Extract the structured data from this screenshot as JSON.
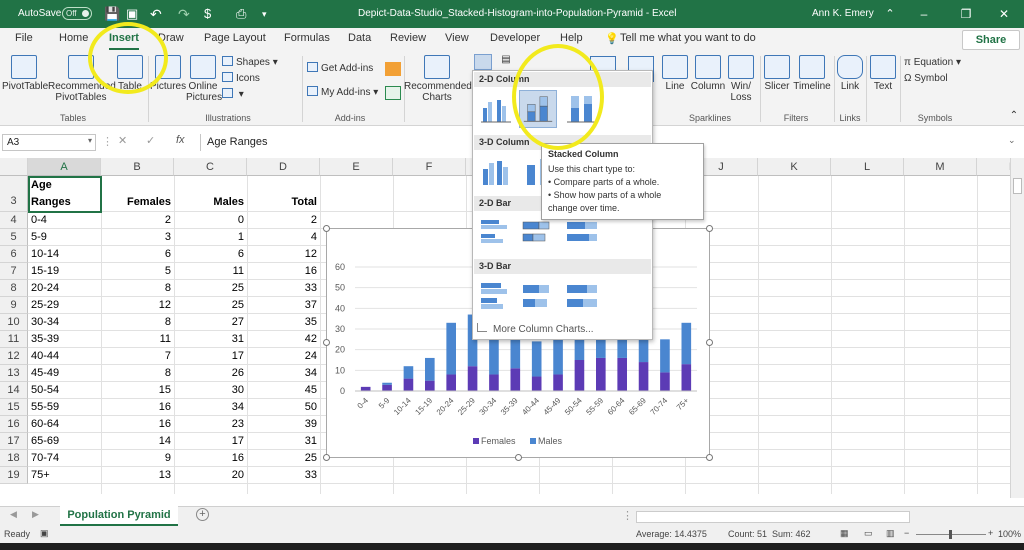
{
  "titlebar": {
    "autosave_label": "AutoSave",
    "autosave_state": "Off",
    "document_title": "Depict-Data-Studio_Stacked-Histogram-into-Population-Pyramid  -  Excel",
    "user_name": "Ann K. Emery",
    "minimize_glyph": "–",
    "restore_glyph": "❐",
    "close_glyph": "✕"
  },
  "tabs": [
    "File",
    "Home",
    "Insert",
    "Draw",
    "Page Layout",
    "Formulas",
    "Data",
    "Review",
    "View",
    "Developer",
    "Help"
  ],
  "active_tab": "Insert",
  "tell_me": "Tell me what you want to do",
  "share_label": "Share",
  "ribbon": {
    "tables": {
      "pivottable": "PivotTable",
      "recommended_line1": "Recommended",
      "recommended_line2": "PivotTables",
      "table": "Table",
      "group": "Tables"
    },
    "illustrations": {
      "pictures": "Pictures",
      "online_line1": "Online",
      "online_line2": "Pictures",
      "shapes": "Shapes",
      "icons": "Icons",
      "group": "Illustrations"
    },
    "addins": {
      "get": "Get Add-ins",
      "my": "My Add-ins",
      "group": "Add-ins"
    },
    "charts": {
      "rec_line1": "Recommended",
      "rec_line2": "Charts"
    },
    "sparklines": {
      "line": "Line",
      "column": "Column",
      "winloss_line1": "Win/",
      "winloss_line2": "Loss",
      "group": "Sparklines"
    },
    "filters": {
      "slicer": "Slicer",
      "timeline": "Timeline",
      "group": "Filters"
    },
    "links": {
      "link": "Link",
      "group": "Links"
    },
    "text": {
      "text": "Text"
    },
    "symbols": {
      "equation": "Equation",
      "symbol": "Symbol",
      "group": "Symbols"
    }
  },
  "formula": {
    "namebox": "A3",
    "fx": "fx",
    "value": "Age Ranges",
    "cancel": "✕",
    "enter": "✓"
  },
  "columns": [
    "A",
    "B",
    "C",
    "D",
    "E",
    "F",
    "G",
    "H",
    "I",
    "J",
    "K",
    "L",
    "M",
    "N"
  ],
  "header_row": {
    "row": "3",
    "a_line1": "Age",
    "a_line2": "Ranges",
    "b": "Females",
    "c": "Males",
    "d": "Total"
  },
  "rows": [
    {
      "n": "4",
      "age": "0-4",
      "f": "2",
      "m": "0",
      "t": "2"
    },
    {
      "n": "5",
      "age": "5-9",
      "f": "3",
      "m": "1",
      "t": "4"
    },
    {
      "n": "6",
      "age": "10-14",
      "f": "6",
      "m": "6",
      "t": "12"
    },
    {
      "n": "7",
      "age": "15-19",
      "f": "5",
      "m": "11",
      "t": "16"
    },
    {
      "n": "8",
      "age": "20-24",
      "f": "8",
      "m": "25",
      "t": "33"
    },
    {
      "n": "9",
      "age": "25-29",
      "f": "12",
      "m": "25",
      "t": "37"
    },
    {
      "n": "10",
      "age": "30-34",
      "f": "8",
      "m": "27",
      "t": "35"
    },
    {
      "n": "11",
      "age": "35-39",
      "f": "11",
      "m": "31",
      "t": "42"
    },
    {
      "n": "12",
      "age": "40-44",
      "f": "7",
      "m": "17",
      "t": "24"
    },
    {
      "n": "13",
      "age": "45-49",
      "f": "8",
      "m": "26",
      "t": "34"
    },
    {
      "n": "14",
      "age": "50-54",
      "f": "15",
      "m": "30",
      "t": "45"
    },
    {
      "n": "15",
      "age": "55-59",
      "f": "16",
      "m": "34",
      "t": "50"
    },
    {
      "n": "16",
      "age": "60-64",
      "f": "16",
      "m": "23",
      "t": "39"
    },
    {
      "n": "17",
      "age": "65-69",
      "f": "14",
      "m": "17",
      "t": "31"
    },
    {
      "n": "18",
      "age": "70-74",
      "f": "9",
      "m": "16",
      "t": "25"
    },
    {
      "n": "19",
      "age": "75+",
      "f": "13",
      "m": "20",
      "t": "33"
    }
  ],
  "dropdown": {
    "sec_2d_column": "2-D Column",
    "sec_3d_column": "3-D Column",
    "sec_2d_bar": "2-D Bar",
    "sec_3d_bar": "3-D Bar",
    "more": "More Column Charts..."
  },
  "tooltip": {
    "title": "Stacked Column",
    "line1": "Use this chart type to:",
    "line2": "• Compare parts of a whole.",
    "line3": "• Show how parts of a whole",
    "line4": "change over time."
  },
  "sheet_tab": "Population Pyramid",
  "status": {
    "ready": "Ready",
    "average": "Average: 14.4375",
    "count": "Count: 51",
    "sum": "Sum: 462",
    "zoom": "100%"
  },
  "colors": {
    "excel_green": "#217346",
    "females": "#5c3bb5",
    "males": "#4a86d0",
    "highlight": "#f2ea1d"
  },
  "chart_data": {
    "type": "bar",
    "stacked": true,
    "categories": [
      "0-4",
      "5-9",
      "10-14",
      "15-19",
      "20-24",
      "25-29",
      "30-34",
      "35-39",
      "40-44",
      "45-49",
      "50-54",
      "55-59",
      "60-64",
      "65-69",
      "70-74",
      "75+"
    ],
    "series": [
      {
        "name": "Females",
        "values": [
          2,
          3,
          6,
          5,
          8,
          12,
          8,
          11,
          7,
          8,
          15,
          16,
          16,
          14,
          9,
          13
        ]
      },
      {
        "name": "Males",
        "values": [
          0,
          1,
          6,
          11,
          25,
          25,
          27,
          31,
          17,
          26,
          30,
          34,
          23,
          17,
          16,
          20
        ]
      }
    ],
    "yticks": [
      "0",
      "10",
      "20",
      "30",
      "40",
      "50",
      "60"
    ],
    "ylim": [
      0,
      60
    ],
    "legend": "bottom",
    "grid": true
  }
}
